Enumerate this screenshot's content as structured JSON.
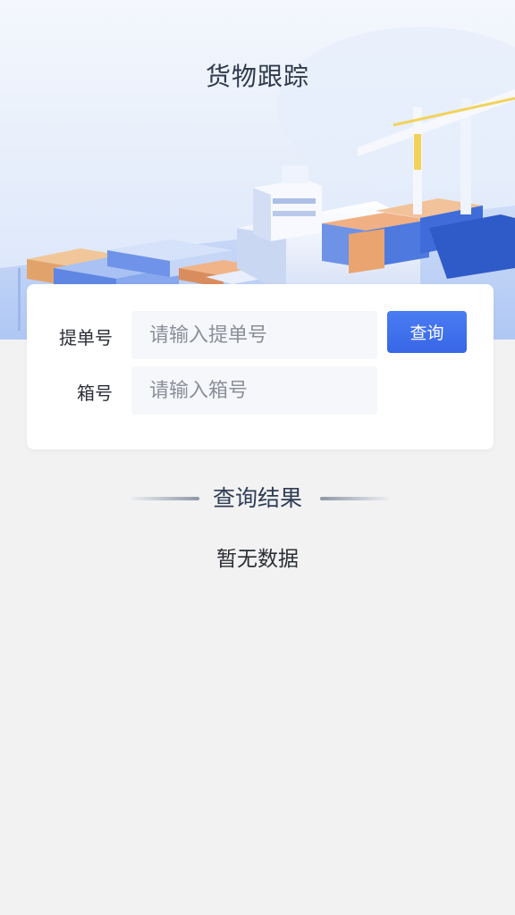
{
  "header": {
    "title": "货物跟踪"
  },
  "search": {
    "bill_label": "提单号",
    "bill_placeholder": "请输入提单号",
    "bill_value": "",
    "box_label": "箱号",
    "box_placeholder": "请输入箱号",
    "box_value": "",
    "query_label": "查询"
  },
  "results": {
    "title": "查询结果",
    "empty_text": "暂无数据"
  },
  "colors": {
    "accent": "#3d6ff0",
    "background": "#f2f2f2",
    "hero_sky": "#e3ecfb"
  }
}
